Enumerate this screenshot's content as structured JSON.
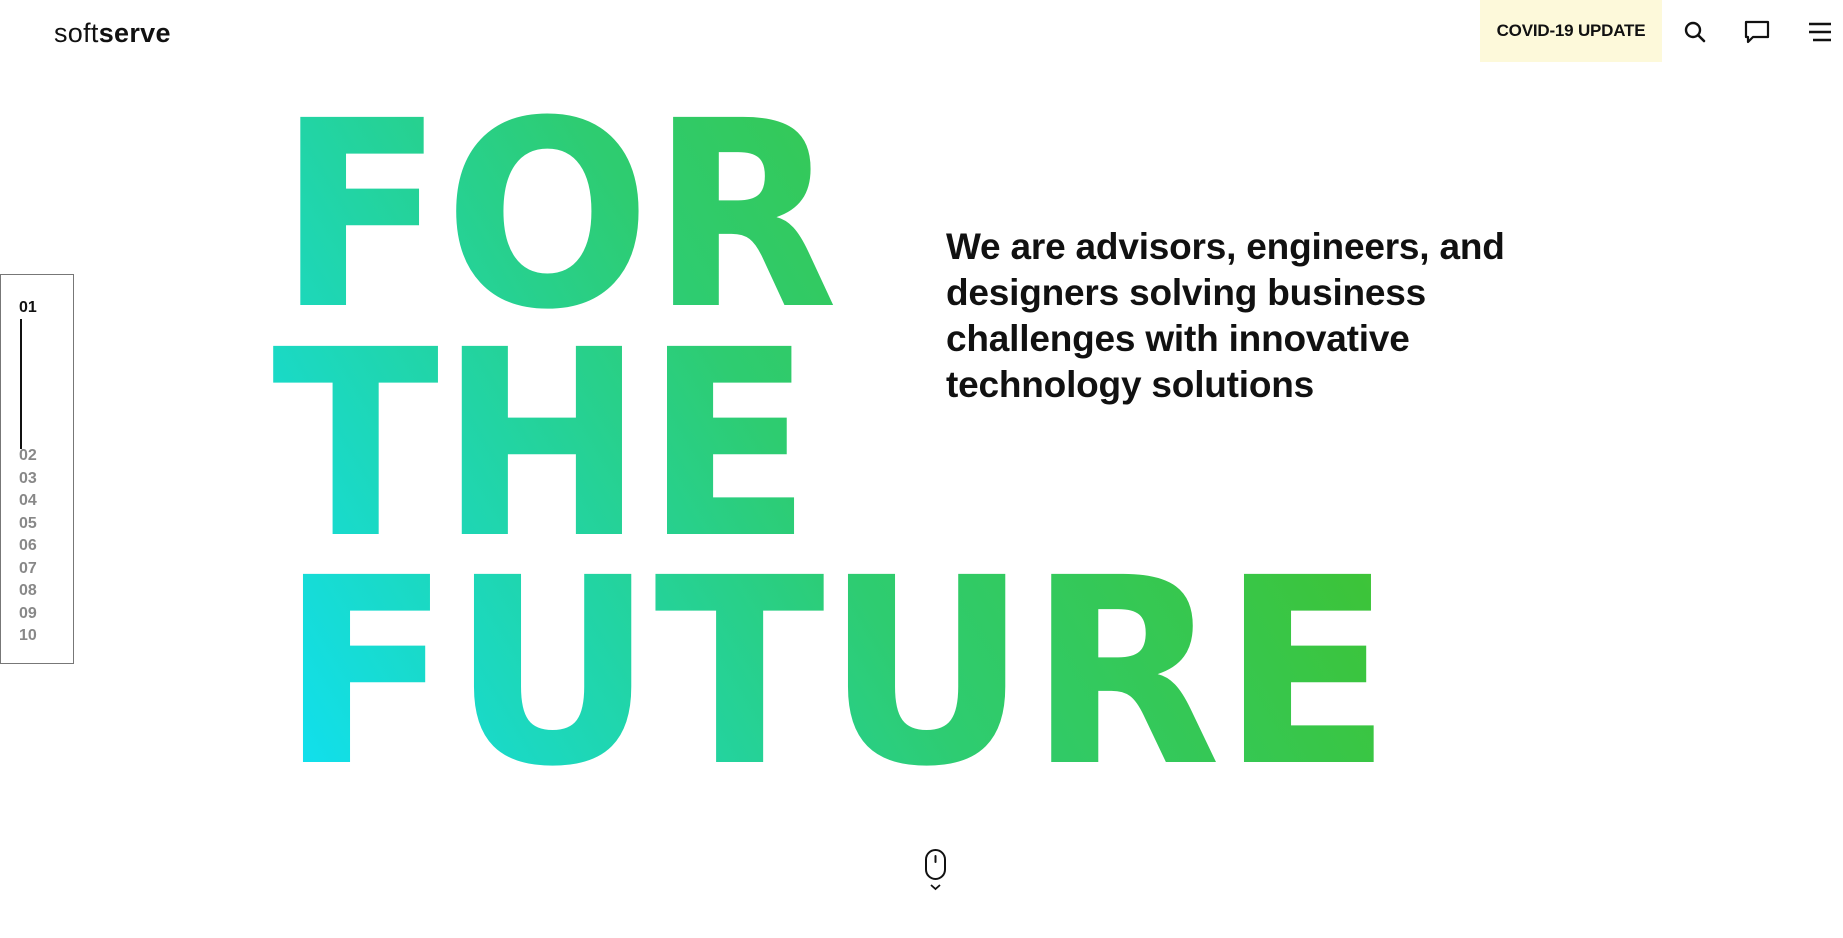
{
  "header": {
    "logo_light": "soft",
    "logo_bold": "serve",
    "covid_label": "COVID-19 UPDATE",
    "icons": [
      "search-icon",
      "chat-icon",
      "menu-icon"
    ]
  },
  "pager": {
    "items": [
      "01",
      "02",
      "03",
      "04",
      "05",
      "06",
      "07",
      "08",
      "09",
      "10"
    ],
    "active_index": 0
  },
  "hero": {
    "lines": [
      "FOR",
      "THE",
      "FUTURE"
    ],
    "gradient": {
      "start": "#10e0f0",
      "mid": "#2ecc71",
      "end": "#7dbb1f",
      "green": "#3cc43a"
    },
    "tagline": "We are advisors, engineers, and designers solving business challenges with innovative technology solutions"
  },
  "scroll": {
    "icon": "mouse-scroll-icon"
  }
}
